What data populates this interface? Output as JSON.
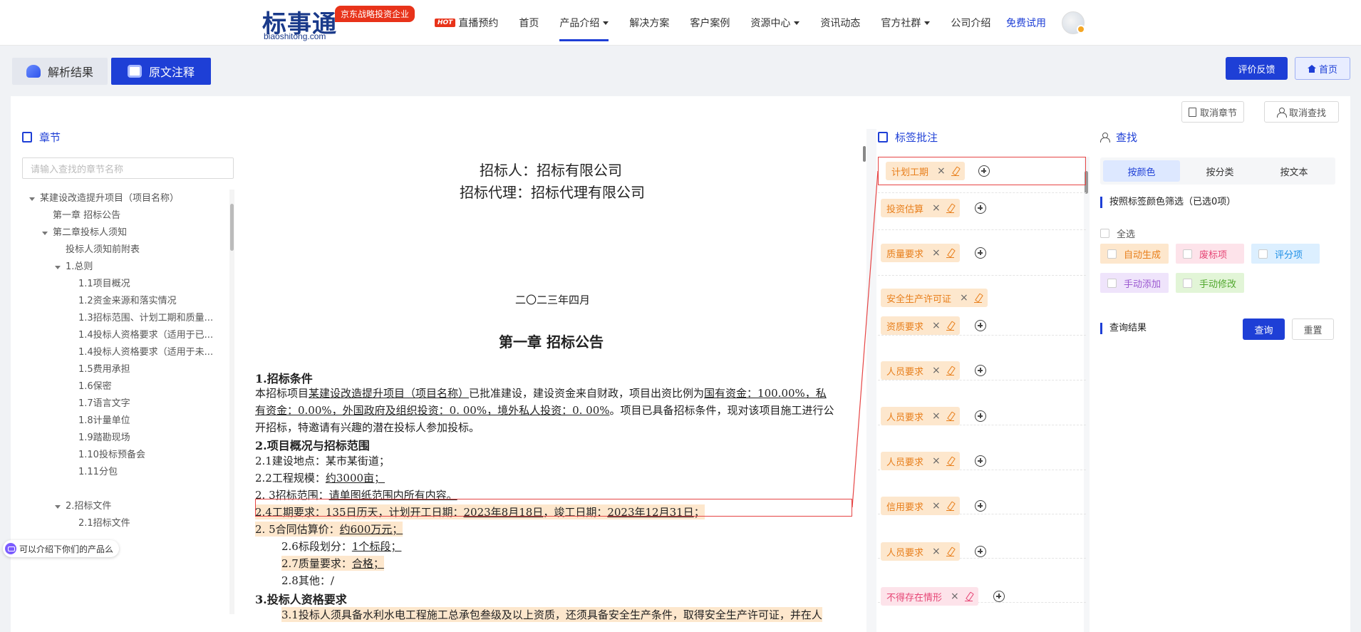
{
  "header": {
    "logo_text": "标事通",
    "logo_sub": "biaoshitong.com",
    "logo_badge": "京东战略投资企业",
    "hot_label": "HOT",
    "nav": [
      {
        "label": "直播预约"
      },
      {
        "label": "首页"
      },
      {
        "label": "产品介绍"
      },
      {
        "label": "解决方案"
      },
      {
        "label": "客户案例"
      },
      {
        "label": "资源中心"
      },
      {
        "label": "资讯动态"
      },
      {
        "label": "官方社群"
      },
      {
        "label": "公司介绍"
      }
    ],
    "free_trial": "免费试用"
  },
  "tabs": {
    "result": "解析结果",
    "original": "原文注释"
  },
  "actions": {
    "feedback": "评价反馈",
    "home": "首页",
    "cancel_chapter": "取消章节",
    "cancel_find": "取消查找"
  },
  "chapter": {
    "title": "章节",
    "search_placeholder": "请输入查找的章节名称",
    "items": [
      "某建设改造提升项目（项目名称）",
      "第一章 招标公告",
      "第二章投标人须知",
      "投标人须知前附表",
      "1.总则",
      "1.1项目概况",
      "1.2资金来源和落实情况",
      "1.3招标范围、计划工期和质量...",
      "1.4投标人资格要求（适用于已...",
      "1.4投标人资格要求（适用于未...",
      "1.5费用承担",
      "1.6保密",
      "1.7语言文字",
      "1.8计量单位",
      "1.9踏勘现场",
      "1.10投标预备会",
      "1.11分包",
      "2.招标文件",
      "2.1招标文件"
    ]
  },
  "chat_bubble": "可以介绍下你们的产品么",
  "document": {
    "line1": "招标人：招标有限公司",
    "line2": "招标代理：招标代理有限公司",
    "date": "二〇二三年四月",
    "chapter_title": "第一章  招标公告",
    "s1": "1.招标条件",
    "p1a_pre": "本招标项目",
    "p1a_u1": "某建设改造提升项目（项目名称）",
    "p1a_mid": "已批准建设，建设资金来自财政，项目出资比例为",
    "p1a_u2": "国有资金：100.00%，私",
    "p1b_u": "有资金：0.00%，外国政府及组织投资：0. 00%，境外私人投资：0. 00%",
    "p1b_post": "。项目已具备招标条件，现对该项目施工进行公",
    "p1c": "开招标，特邀请有兴趣的潜在投标人参加投标。",
    "s2": "2.项目概况与招标范围",
    "l21_pre": "2.1建设地点：",
    "l21_val": "某市某街道；",
    "l22_pre": "2.2工程规模：",
    "l22_val": "约3000亩；",
    "l23_pre": "2.  3招标范围：",
    "l23_val": "请单图纸范围内所有内容。",
    "l24_pre": "2.4工期要求：135日历天，计划开工日期：",
    "l24_d1": "2023年8月18日",
    "l24_mid": "，竣工日期：",
    "l24_d2": "2023年12月31日",
    "l24_post": "；",
    "l25_pre": "2.  5合同估算价：",
    "l25_val": "约600万元；",
    "l26_pre": "2.6标段划分：",
    "l26_val": "1个标段；",
    "l27_pre": "2.7质量要求：",
    "l27_val": "合格；",
    "l28": "2.8其他：/",
    "s3": "3.投标人资格要求",
    "l31": "3.1投标人须具备水利水电工程施工总承包叁级及以上资质，还须具备安全生产条件，取得安全生产许可证，并在人"
  },
  "tags": {
    "title": "标签批注",
    "rows": [
      {
        "label": "计划工期",
        "color": "orange"
      },
      {
        "label": "投资估算",
        "color": "orange"
      },
      {
        "label": "质量要求",
        "color": "orange"
      },
      {
        "label": "安全生产许可证",
        "color": "orange"
      },
      {
        "label": "资质要求",
        "color": "orange"
      },
      {
        "label": "人员要求",
        "color": "orange"
      },
      {
        "label": "人员要求",
        "color": "orange"
      },
      {
        "label": "人员要求",
        "color": "orange"
      },
      {
        "label": "信用要求",
        "color": "orange"
      },
      {
        "label": "人员要求",
        "color": "orange"
      },
      {
        "label": "不得存在情形",
        "color": "pink"
      }
    ],
    "close_glyph": "×"
  },
  "find": {
    "title": "查找",
    "segments": [
      "按颜色",
      "按分类",
      "按文本"
    ],
    "filter_title": "按照标签颜色筛选（已选0项）",
    "select_all": "全选",
    "chips": [
      {
        "label": "自动生成",
        "bg": "#fde7cd",
        "fg": "#e87f1c"
      },
      {
        "label": "废标项",
        "bg": "#fde3ea",
        "fg": "#e64575"
      },
      {
        "label": "评分项",
        "bg": "#dcefff",
        "fg": "#1e8fe6"
      },
      {
        "label": "手动添加",
        "bg": "#efe4fb",
        "fg": "#9b59d0"
      },
      {
        "label": "手动修改",
        "bg": "#e2f5d7",
        "fg": "#52a82f"
      }
    ],
    "result_title": "查询结果",
    "query": "查询",
    "reset": "重置"
  }
}
